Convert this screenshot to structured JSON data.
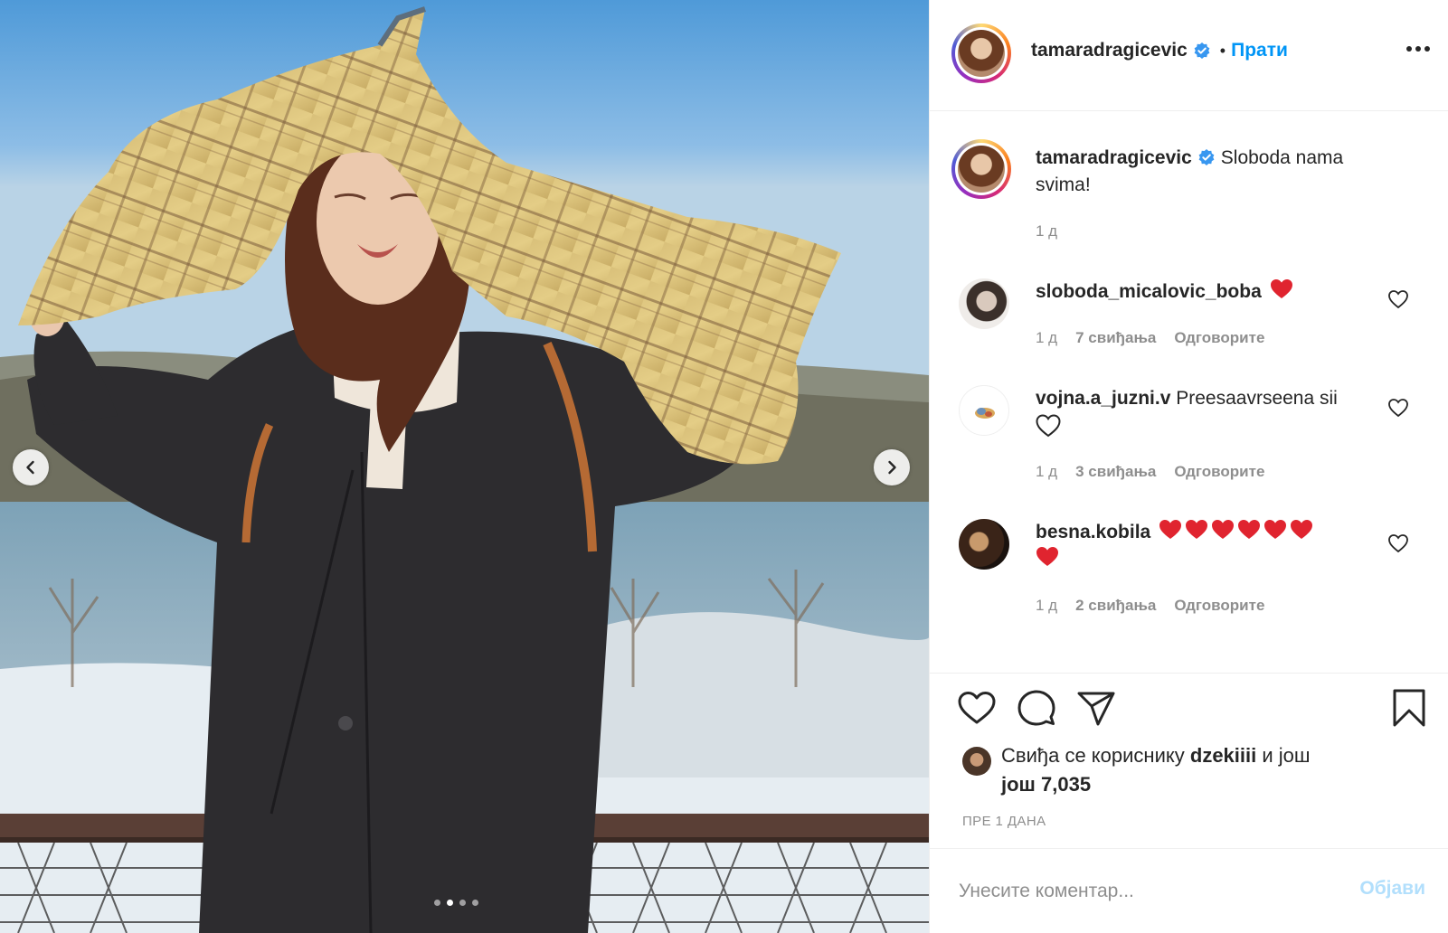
{
  "post_image": {
    "description_icon": "photo",
    "carousel_dots": 4,
    "active_dot": 1
  },
  "header": {
    "username": "tamaradragicevic",
    "separator": "•",
    "follow_label": "Прати"
  },
  "caption": {
    "username": "tamaradragicevic",
    "text_line1": "Sloboda nama",
    "text_line2": "svima!",
    "time": "1 д"
  },
  "comments": [
    {
      "username": "sloboda_micalovic_boba",
      "text": "",
      "time": "1 д",
      "likes": "7 свиђања",
      "reply_label": "Одговорите"
    },
    {
      "username": "vojna.a_juzni.v",
      "text": "Preesaavrseena sii",
      "time": "1 д",
      "likes": "3 свиђања",
      "reply_label": "Одговорите"
    },
    {
      "username": "besna.kobila",
      "text": "",
      "time": "1 д",
      "likes": "2 свиђања",
      "reply_label": "Одговорите"
    }
  ],
  "likes": {
    "prefix": "Свиђа се кориснику",
    "user": "dzekiiii",
    "suffix": "и још",
    "count_line": "још 7,035"
  },
  "post_date": "ПРЕ 1 ДАНА",
  "add_comment": {
    "placeholder": "Унесите коментар...",
    "post_label": "Објави"
  },
  "colors": {
    "accent": "#0095f6",
    "heart_red": "#ed4956",
    "muted": "#8e8e8e",
    "post_disabled": "#b2dffc"
  }
}
